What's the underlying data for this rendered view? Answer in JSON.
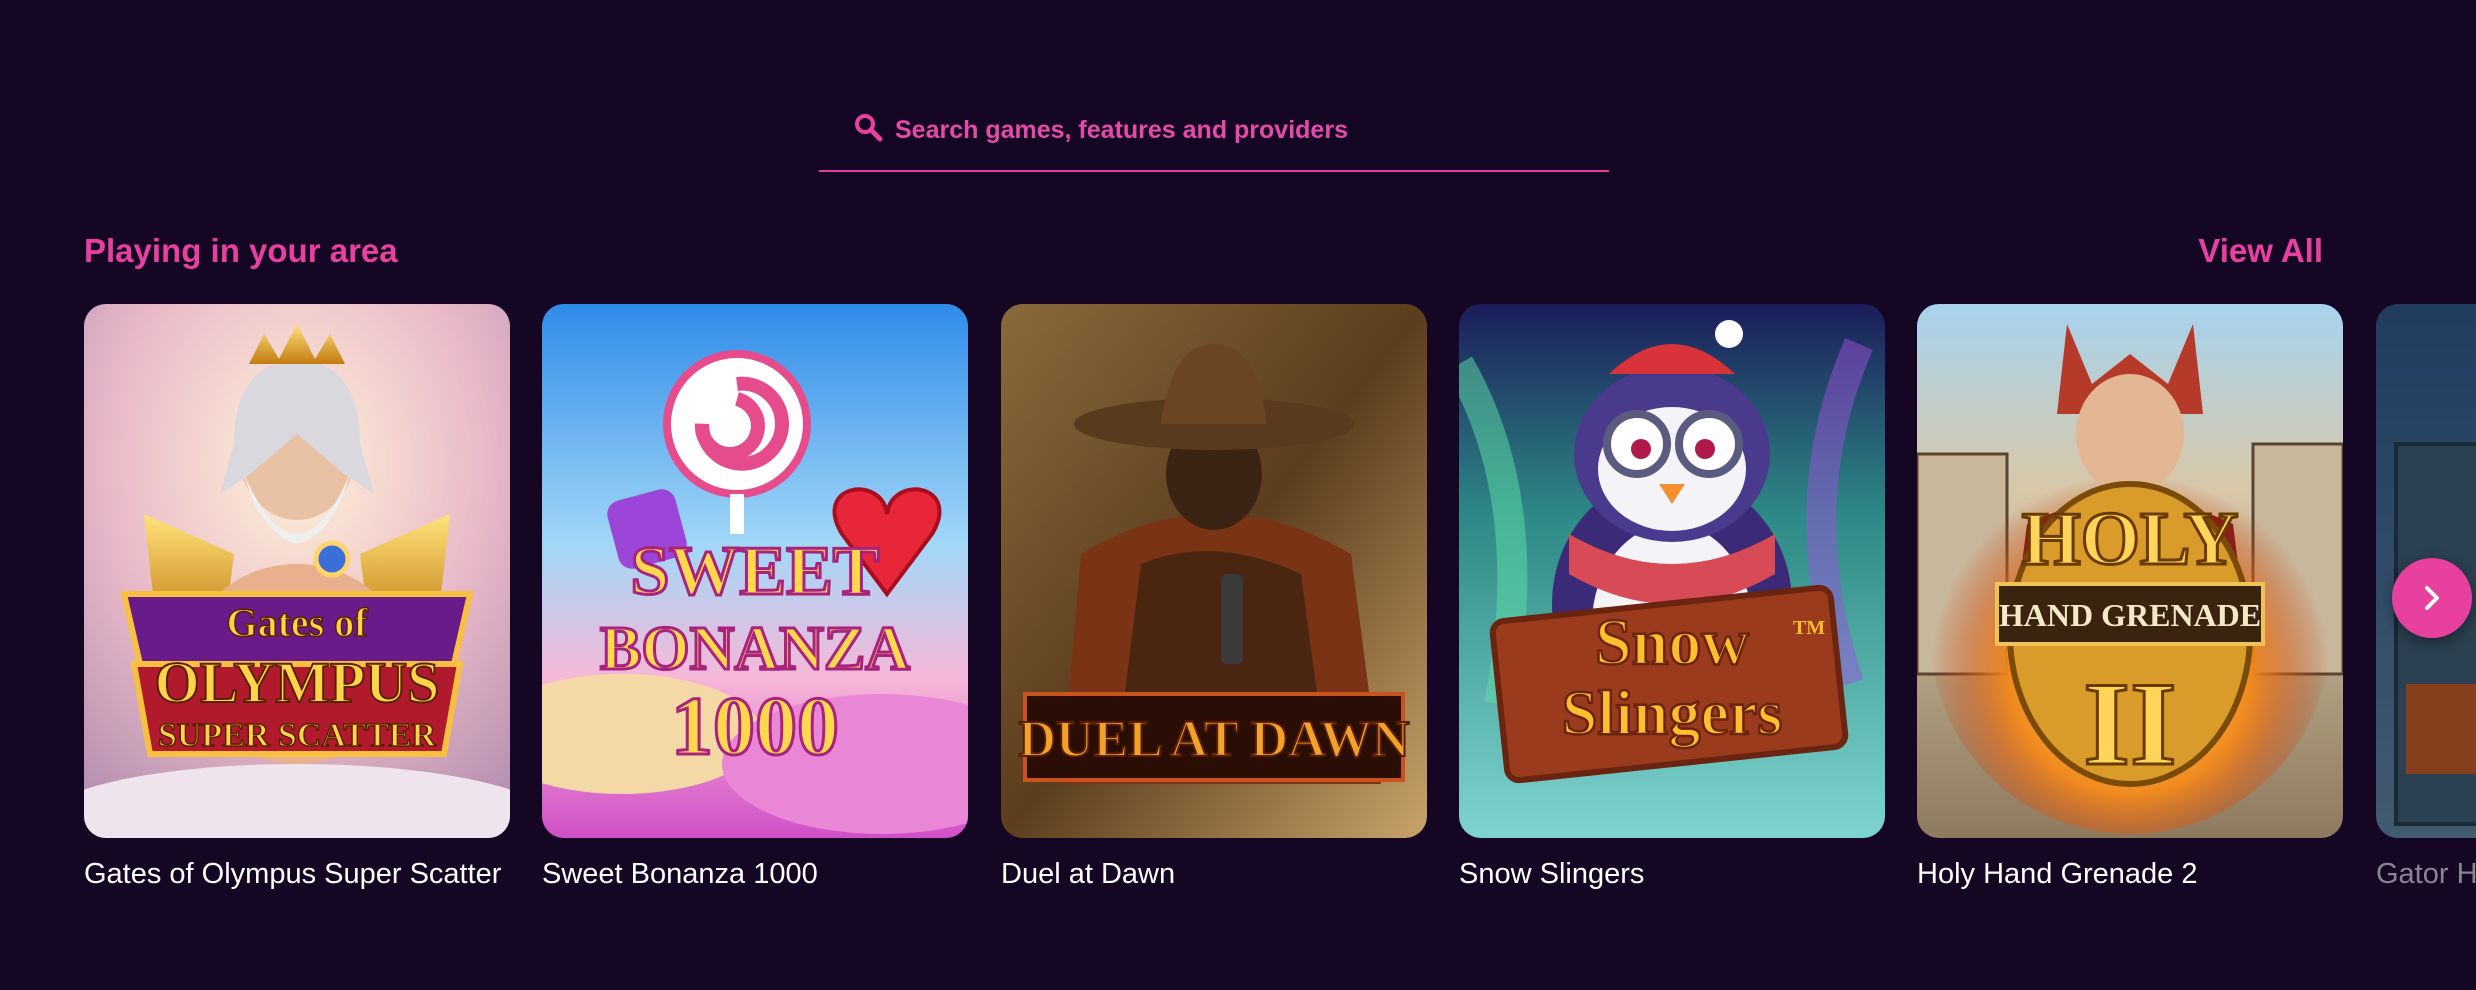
{
  "search": {
    "placeholder": "Search games, features and providers",
    "icon": "search-icon"
  },
  "section": {
    "title": "Playing in your area",
    "view_all_label": "View All"
  },
  "games": [
    {
      "title": "Gates of Olympus Super Scatter",
      "art_lines": [
        "Gates of",
        "OLYMPUS",
        "SUPER SCATTER"
      ]
    },
    {
      "title": "Sweet Bonanza 1000",
      "art_lines": [
        "SWEET",
        "BONANZA",
        "1000"
      ]
    },
    {
      "title": "Duel at Dawn",
      "art_lines": [
        "DUEL AT DAWN"
      ]
    },
    {
      "title": "Snow Slingers",
      "art_lines": [
        "Snow",
        "Slingers",
        "TM"
      ]
    },
    {
      "title": "Holy Hand Grenade 2",
      "art_lines": [
        "HOLY",
        "HAND GRENADE",
        "II"
      ]
    },
    {
      "title": "Gator H"
    }
  ],
  "colors": {
    "background": "#150724",
    "accent": "#e8409f",
    "card_title": "#ffffff",
    "dim_title": "#8a8398"
  },
  "carousel": {
    "next_icon": "chevron-right-icon"
  }
}
